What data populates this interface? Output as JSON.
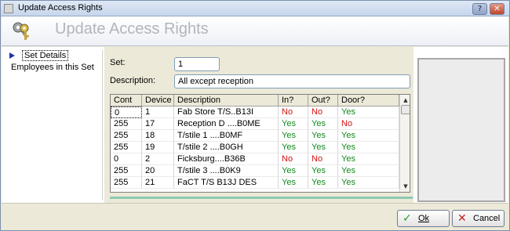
{
  "window": {
    "title": "Update Access Rights",
    "help_glyph": "?",
    "close_glyph": "✕"
  },
  "header": {
    "heading": "Update Access Rights",
    "icon": "keys-icon"
  },
  "nav": {
    "items": [
      {
        "label": "Set Details",
        "selected": true
      },
      {
        "label": "Employees in this Set",
        "selected": false
      }
    ]
  },
  "form": {
    "set_label": "Set:",
    "set_value": "1",
    "description_label": "Description:",
    "description_value": "All except reception"
  },
  "grid": {
    "columns": [
      "Cont",
      "Device",
      "Description",
      "In?",
      "Out?",
      "Door?"
    ],
    "rows": [
      {
        "cont": "0",
        "device": "1",
        "description": "Fab Store T/S..B13I",
        "in": "No",
        "out": "No",
        "door": "Yes"
      },
      {
        "cont": "255",
        "device": "17",
        "description": "Reception D ....B0ME",
        "in": "Yes",
        "out": "Yes",
        "door": "No"
      },
      {
        "cont": "255",
        "device": "18",
        "description": "T/stile 1 ....B0MF",
        "in": "Yes",
        "out": "Yes",
        "door": "Yes"
      },
      {
        "cont": "255",
        "device": "19",
        "description": "T/stile 2 ....B0GH",
        "in": "Yes",
        "out": "Yes",
        "door": "Yes"
      },
      {
        "cont": "0",
        "device": "2",
        "description": "Ficksburg....B36B",
        "in": "No",
        "out": "No",
        "door": "Yes"
      },
      {
        "cont": "255",
        "device": "20",
        "description": "T/stile 3 ....B0K9",
        "in": "Yes",
        "out": "Yes",
        "door": "Yes"
      },
      {
        "cont": "255",
        "device": "21",
        "description": "FaCT T/S B13J DES",
        "in": "Yes",
        "out": "Yes",
        "door": "Yes"
      }
    ],
    "scroll_up_glyph": "▲",
    "scroll_down_glyph": "▼"
  },
  "colors": {
    "yes": "#118a1c",
    "no": "#d21212"
  },
  "footer": {
    "ok_label": "Ok",
    "ok_glyph": "✓",
    "cancel_label": "Cancel",
    "cancel_glyph": "✕"
  }
}
